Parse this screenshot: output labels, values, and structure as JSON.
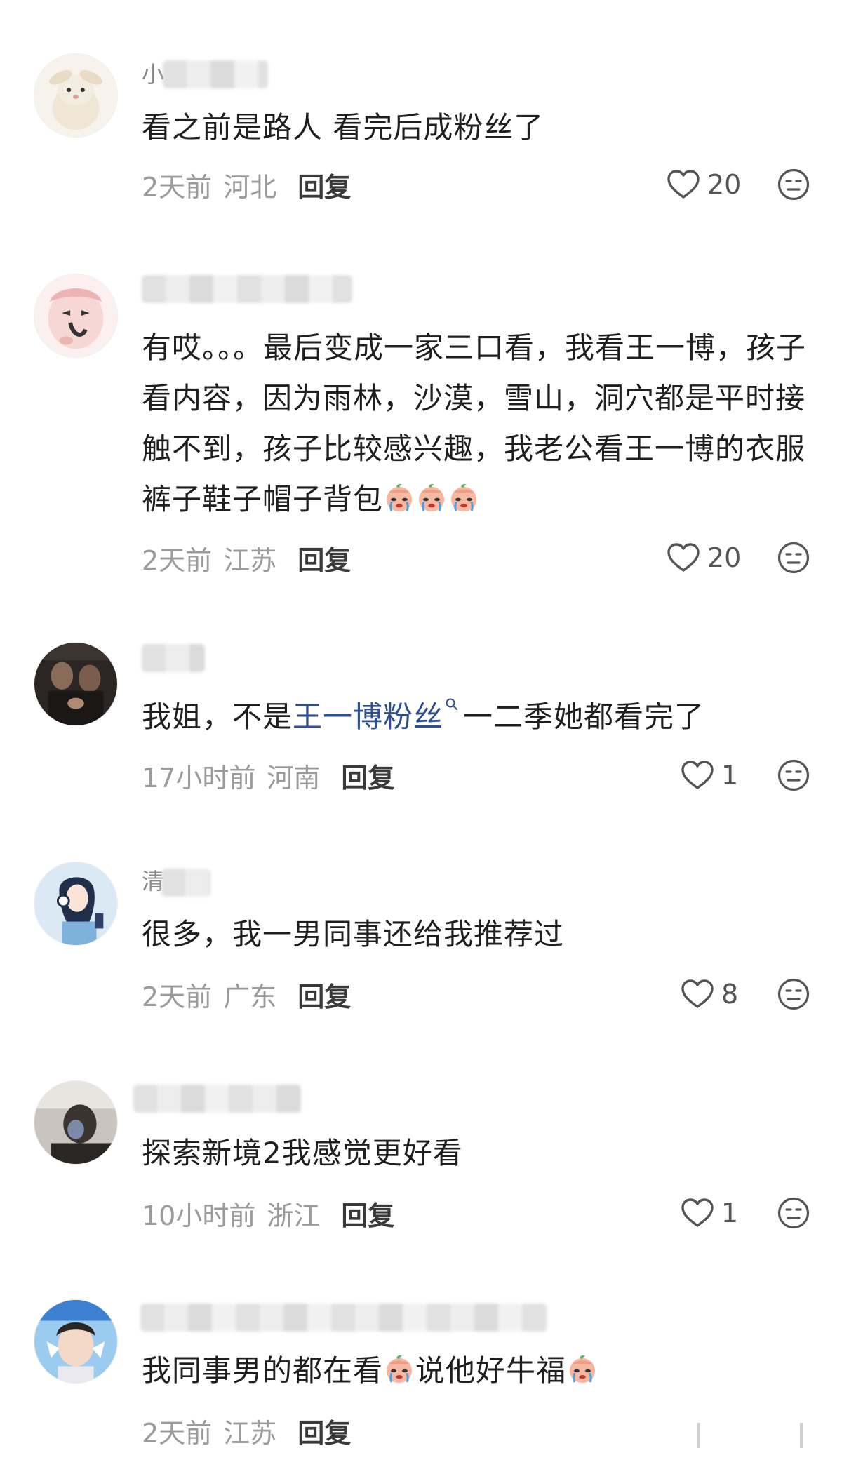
{
  "comments": [
    {
      "username_hint": "小",
      "text": "看之前是路人 看完后成粉丝了",
      "time": "2天前",
      "location": "河北",
      "reply_label": "回复",
      "likes": "20"
    },
    {
      "username_hint": "",
      "text": "有哎。。。最后变成一家三口看，我看王一博，孩子看内容，因为雨林，沙漠，雪山，洞穴都是平时接触不到，孩子比较感兴趣，我老公看王一博的衣服裤子鞋子帽子背包",
      "time": "2天前",
      "location": "江苏",
      "reply_label": "回复",
      "likes": "20"
    },
    {
      "username_hint": "",
      "text_before": "我姐，不是",
      "link_text": "王一博粉丝",
      "text_after": "一二季她都看完了",
      "time": "17小时前",
      "location": "河南",
      "reply_label": "回复",
      "likes": "1"
    },
    {
      "username_hint": "清",
      "text": "很多，我一男同事还给我推荐过",
      "time": "2天前",
      "location": "广东",
      "reply_label": "回复",
      "likes": "8"
    },
    {
      "username_hint": "",
      "text": "探索新境2我感觉更好看",
      "time": "10小时前",
      "location": "浙江",
      "reply_label": "回复",
      "likes": "1"
    },
    {
      "username_hint": "",
      "text_before": "我同事男的都在看",
      "text_middle": "说他好牛福",
      "time": "2天前",
      "location": "江苏",
      "reply_label": "回复"
    }
  ],
  "icons": {
    "like": "heart-outline-icon",
    "dislike": "neutral-face-icon",
    "emoji": "crying-peach-emoji",
    "search_mark": "search-icon"
  },
  "colors": {
    "text": "#1f1f1f",
    "meta": "#9b9b9b",
    "link": "#2f4e8c"
  }
}
